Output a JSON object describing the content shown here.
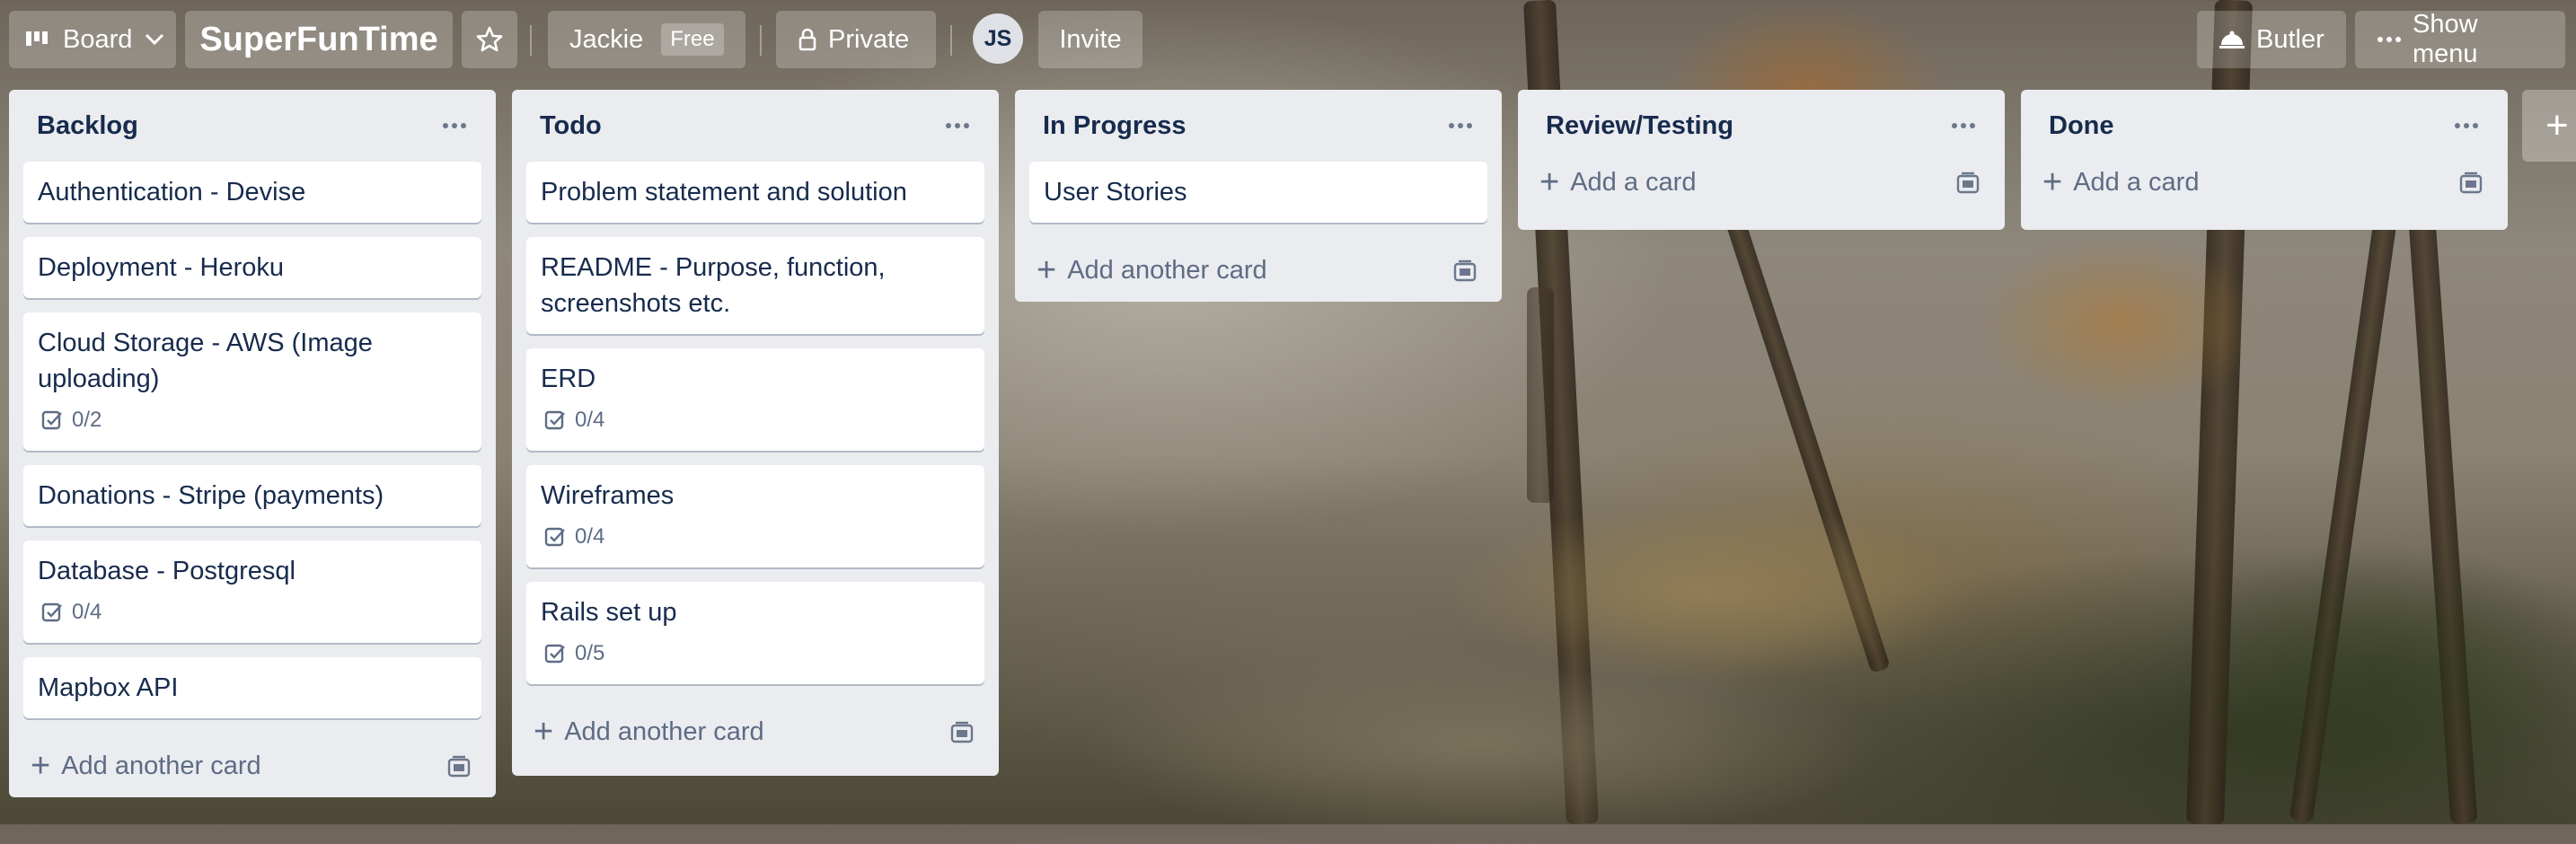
{
  "header": {
    "board_switcher_label": "Board",
    "board_title": "SuperFunTime",
    "workspace_label": "Jackie",
    "workspace_badge": "Free",
    "visibility_label": "Private",
    "avatar_initials": "JS",
    "invite_label": "Invite",
    "butler_label": "Butler",
    "show_menu_label": "Show menu"
  },
  "lists": [
    {
      "title": "Backlog",
      "add_label": "Add another card",
      "cards": [
        {
          "title": "Authentication - Devise"
        },
        {
          "title": "Deployment - Heroku"
        },
        {
          "title": "Cloud Storage - AWS (Image uploading)",
          "checklist": "0/2"
        },
        {
          "title": "Donations - Stripe (payments)"
        },
        {
          "title": "Database - Postgresql",
          "checklist": "0/4"
        },
        {
          "title": "Mapbox API"
        }
      ]
    },
    {
      "title": "Todo",
      "add_label": "Add another card",
      "cards": [
        {
          "title": "Problem statement and solution"
        },
        {
          "title": "README - Purpose, function, screenshots etc."
        },
        {
          "title": "ERD",
          "checklist": "0/4"
        },
        {
          "title": "Wireframes",
          "checklist": "0/4"
        },
        {
          "title": "Rails set up",
          "checklist": "0/5"
        }
      ]
    },
    {
      "title": "In Progress",
      "add_label": "Add another card",
      "cards": [
        {
          "title": "User Stories"
        }
      ]
    },
    {
      "title": "Review/Testing",
      "add_label": "Add a card",
      "cards": []
    },
    {
      "title": "Done",
      "add_label": "Add a card",
      "cards": []
    }
  ],
  "icons": {
    "board": "board-icon",
    "chevron": "chevron-down-icon",
    "star": "star-icon",
    "lock": "lock-icon",
    "butler": "butler-icon",
    "more": "ellipsis-icon",
    "plus": "plus-icon",
    "template": "card-template-icon",
    "checklist": "checklist-icon"
  }
}
